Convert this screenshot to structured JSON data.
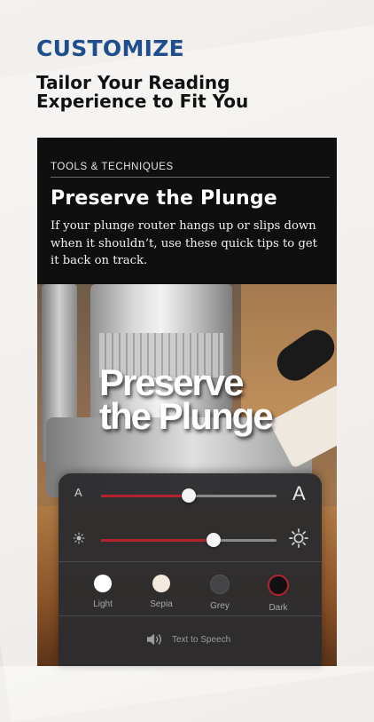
{
  "promo": {
    "headline": "CUSTOMIZE",
    "subheadline": "Tailor Your Reading\nExperience to Fit You"
  },
  "article": {
    "kicker": "TOOLS & TECHNIQUES",
    "title": "Preserve the Plunge",
    "dek": "If your plunge router hangs up or slips down when it shouldn’t, use these quick tips to get it back on track.",
    "hero_overlay_line1": "Preserve",
    "hero_overlay_line2": "the Plunge"
  },
  "reader_settings": {
    "font_size": {
      "small_label": "A",
      "large_label": "A",
      "value": 0.5
    },
    "brightness": {
      "value": 0.64,
      "small_icon": "sun-small-icon",
      "large_icon": "sun-large-icon"
    },
    "accent_color": "#b5232e",
    "themes": [
      {
        "label": "Light",
        "color": "#ffffff",
        "selected": false
      },
      {
        "label": "Sepia",
        "color": "#f3e9dc",
        "selected": false
      },
      {
        "label": "Grey",
        "color": "#444446",
        "selected": false
      },
      {
        "label": "Dark",
        "color": "#111111",
        "selected": true
      }
    ],
    "text_to_speech": {
      "label": "Text to Speech",
      "icon": "speaker-icon"
    }
  }
}
